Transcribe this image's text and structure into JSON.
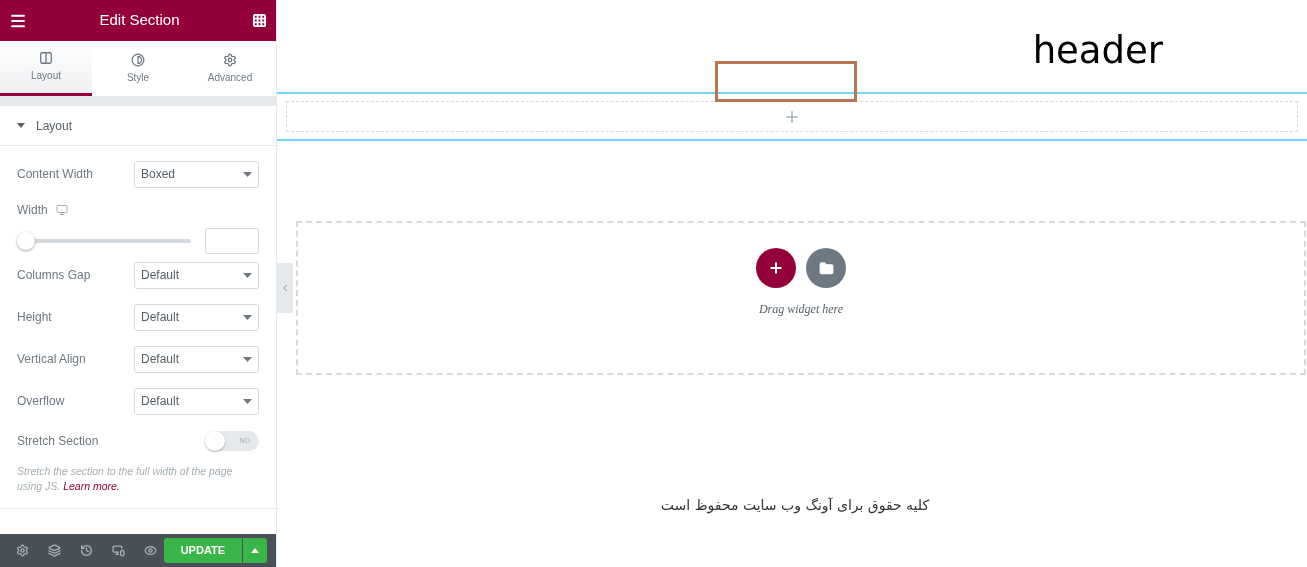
{
  "panel": {
    "title": "Edit Section",
    "tabs": [
      {
        "label": "Layout",
        "selected": true
      },
      {
        "label": "Style",
        "selected": false
      },
      {
        "label": "Advanced",
        "selected": false
      }
    ],
    "section": {
      "title": "Layout",
      "expanded": true
    },
    "controls": [
      {
        "kind": "select",
        "label": "Content Width",
        "value": "Boxed"
      },
      {
        "kind": "slider",
        "label": "Width",
        "level": 0
      },
      {
        "kind": "select",
        "label": "Columns Gap",
        "value": "Default"
      },
      {
        "kind": "select",
        "label": "Height",
        "value": "Default"
      },
      {
        "kind": "select",
        "label": "Vertical Align",
        "value": "Default"
      },
      {
        "kind": "select",
        "label": "Overflow",
        "value": "Default"
      },
      {
        "kind": "switch",
        "label": "Stretch Section",
        "on": false,
        "state_text": "NO"
      }
    ],
    "help": {
      "text": "Stretch the section to the full width of the page using JS.",
      "link": "Learn more."
    },
    "footer": {
      "update": "UPDATE"
    }
  },
  "canvas": {
    "heading": "header",
    "drop_zone": {
      "text": "Drag widget here"
    },
    "footer_text": "کلیه حقوق برای آونگ وب سایت محفوظ است"
  }
}
